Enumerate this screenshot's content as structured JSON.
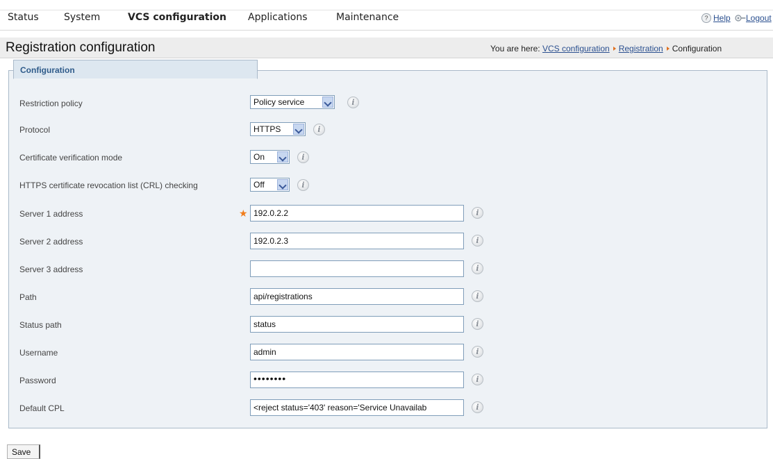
{
  "nav": {
    "items": [
      {
        "label": "Status"
      },
      {
        "label": "System"
      },
      {
        "label": "VCS configuration"
      },
      {
        "label": "Applications"
      },
      {
        "label": "Maintenance"
      }
    ],
    "help": "Help",
    "logout": "Logout"
  },
  "header": {
    "title": "Registration configuration",
    "breadcrumb_prefix": "You are here:",
    "crumbs": [
      "VCS configuration",
      "Registration",
      "Configuration"
    ]
  },
  "panel": {
    "tab": "Configuration",
    "fields": {
      "restriction_policy": {
        "label": "Restriction policy",
        "value": "Policy service"
      },
      "protocol": {
        "label": "Protocol",
        "value": "HTTPS"
      },
      "cert_verification": {
        "label": "Certificate verification mode",
        "value": "On"
      },
      "crl_checking": {
        "label": "HTTPS certificate revocation list (CRL) checking",
        "value": "Off"
      },
      "server1": {
        "label": "Server 1 address",
        "value": "192.0.2.2"
      },
      "server2": {
        "label": "Server 2 address",
        "value": "192.0.2.3"
      },
      "server3": {
        "label": "Server 3 address",
        "value": ""
      },
      "path": {
        "label": "Path",
        "value": "api/registrations"
      },
      "status_path": {
        "label": "Status path",
        "value": "status"
      },
      "username": {
        "label": "Username",
        "value": "admin"
      },
      "password": {
        "label": "Password",
        "value": "••••••••"
      },
      "default_cpl": {
        "label": "Default CPL",
        "value": "<reject status='403' reason='Service Unavailab"
      }
    },
    "info_icon": "i",
    "required_marker": "★"
  },
  "actions": {
    "save": "Save"
  },
  "colors": {
    "link": "#2a4f8f",
    "panel_bg": "#eef2f6",
    "required": "#f07c1a"
  }
}
